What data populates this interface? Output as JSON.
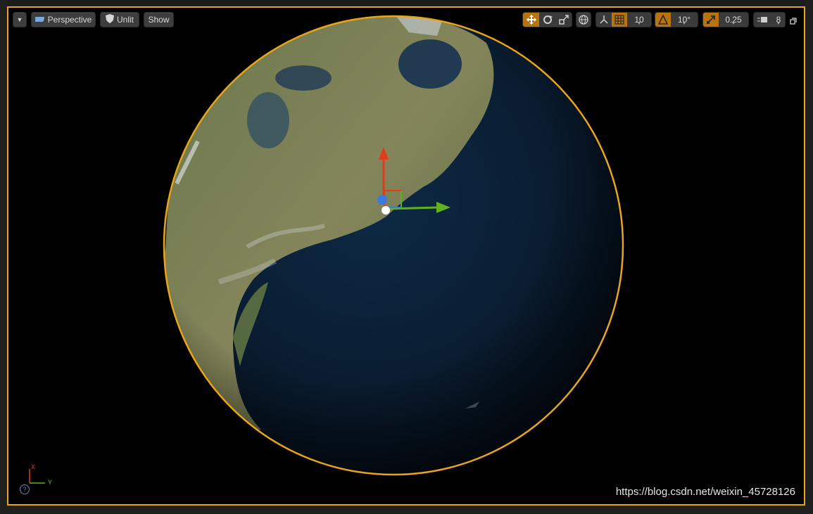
{
  "toolbar": {
    "menu_label": "",
    "perspective_label": "Perspective",
    "unlit_label": "Unlit",
    "show_label": "Show",
    "grid_snap_value": "10",
    "rotation_snap_value": "10°",
    "scale_snap_value": "0.25",
    "camera_speed_value": "8"
  },
  "axes": {
    "x_label": "X",
    "y_label": "Y"
  },
  "watermark": "https://blog.csdn.net/weixin_45728126",
  "help_label": "?",
  "colors": {
    "selection_outline": "#e8a51c",
    "axis_x": "#e03c1c",
    "axis_y": "#5fb21e",
    "axis_z": "#3b7be0",
    "active_tool": "#b8730f"
  }
}
